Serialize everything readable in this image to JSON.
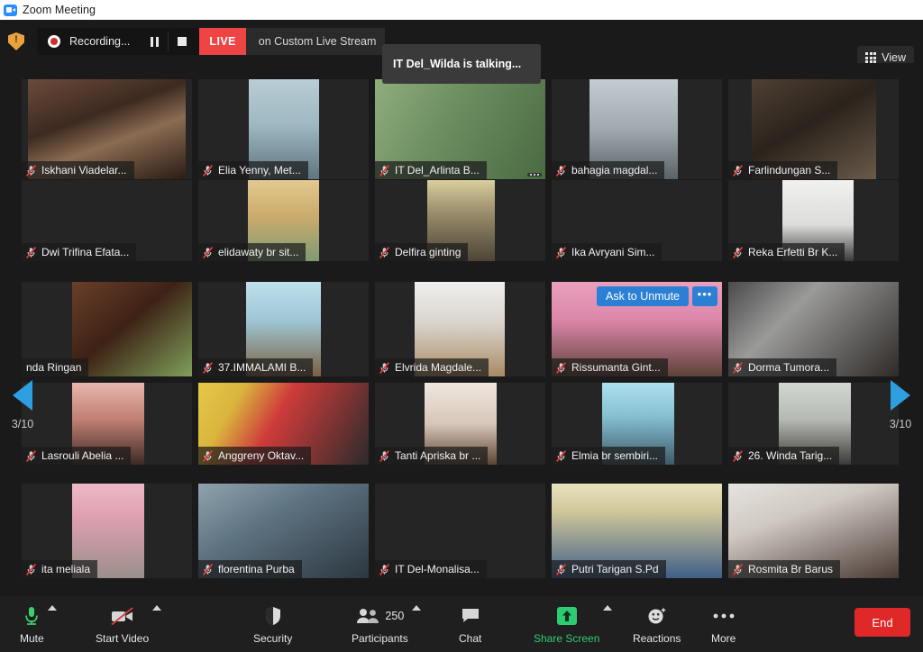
{
  "window": {
    "title": "Zoom Meeting",
    "logo_icon": "zoom-logo-icon"
  },
  "topbar": {
    "shield_icon": "security-shield-icon",
    "recording": {
      "label": "Recording...",
      "record_icon": "record-dot-icon",
      "pause_icon": "pause-icon",
      "stop_icon": "stop-icon"
    },
    "live": {
      "badge": "LIVE",
      "text": "on Custom Live Stream"
    },
    "talking_tooltip": "IT Del_Wilda is talking...",
    "view": {
      "label": "View",
      "icon": "grid-view-icon"
    }
  },
  "gallery": {
    "page_left": "3/10",
    "page_right": "3/10",
    "prev_icon": "chevron-left-icon",
    "next_icon": "chevron-right-icon",
    "mute_icon": "muted-microphone-icon",
    "unmute_prompt": {
      "label": "Ask to Unmute",
      "more_label": "•••"
    },
    "rows": [
      {
        "cells": [
          {
            "name": "Iskhani Viadelar...",
            "muted": true,
            "video": true,
            "vx": 7,
            "vy": 0,
            "vw": 175,
            "vh": 111,
            "bg": "linear-gradient(160deg,#6b4b3a 0%,#3d2a20 38%,#8a6c52 60%,#2a1c14 100%)"
          },
          {
            "name": "Elia Yenny, Met...",
            "muted": true,
            "video": true,
            "vx": 56,
            "vy": 0,
            "vw": 78,
            "vh": 111,
            "bg": "linear-gradient(180deg,#b9cdd4 0%,#9fb8c2 45%,#5f7580 100%)"
          },
          {
            "name": "IT Del_Arlinta B...",
            "muted": true,
            "video": true,
            "vx": 0,
            "vy": 0,
            "vw": 189,
            "vh": 111,
            "bg": "linear-gradient(120deg,#8fae7e 0%,#6d8f62 40%,#4a6a42 100%)",
            "sharedots": true
          },
          {
            "name": "bahagia magdal...",
            "muted": true,
            "video": true,
            "vx": 42,
            "vy": 0,
            "vw": 98,
            "vh": 111,
            "bg": "linear-gradient(180deg,#c3cdd2 0%,#9fa9ae 50%,#5b6267 100%)"
          },
          {
            "name": "Farlindungan S...",
            "muted": true,
            "video": true,
            "vx": 26,
            "vy": 0,
            "vw": 138,
            "vh": 111,
            "bg": "linear-gradient(150deg,#4e4034 0%,#2b231c 45%,#6a5a49 100%)"
          }
        ]
      },
      {
        "cells": [
          {
            "name": "Dwi Trifina Efata...",
            "muted": true,
            "video": false,
            "vx": 0,
            "vy": 0,
            "vw": 0,
            "vh": 0,
            "bg": ""
          },
          {
            "name": "elidawaty br sit...",
            "muted": true,
            "video": true,
            "vx": 55,
            "vy": 0,
            "vw": 79,
            "vh": 90,
            "bg": "linear-gradient(180deg,#e2c98f 0%,#cbab6c 45%,#7f9a74 100%)"
          },
          {
            "name": "Delfira ginting",
            "muted": true,
            "video": true,
            "vx": 58,
            "vy": 0,
            "vw": 75,
            "vh": 90,
            "bg": "linear-gradient(180deg,#d9cf9e 0%,#9a8d6b 40%,#4c4436 100%)"
          },
          {
            "name": "Ika Avryani Sim...",
            "muted": true,
            "video": false,
            "vx": 0,
            "vy": 0,
            "vw": 0,
            "vh": 0,
            "bg": ""
          },
          {
            "name": "Reka Erfetti Br K...",
            "muted": true,
            "video": true,
            "vx": 60,
            "vy": 0,
            "vw": 79,
            "vh": 90,
            "bg": "linear-gradient(180deg,#f1f1ef 0%,#dcdcda 55%,#3a3a3c 100%)"
          }
        ]
      },
      {
        "cells": [
          {
            "name": "nda Ringan",
            "muted": false,
            "video": true,
            "vx": 56,
            "vy": 0,
            "vw": 133,
            "vh": 105,
            "bg": "linear-gradient(140deg,#6a3f2a 0%,#3d2215 45%,#7fa05a 100%)"
          },
          {
            "name": "37.IMMALAMI B...",
            "muted": true,
            "video": true,
            "vx": 53,
            "vy": 0,
            "vw": 83,
            "vh": 105,
            "bg": "linear-gradient(180deg,#bfe0ec 0%,#9ec7d6 40%,#7a6040 100%)"
          },
          {
            "name": "Elvrida Magdale...",
            "muted": true,
            "video": true,
            "vx": 44,
            "vy": 0,
            "vw": 100,
            "vh": 105,
            "bg": "linear-gradient(180deg,#f0efed 0%,#d9d3cb 45%,#a98a63 100%)"
          },
          {
            "name": "Rissumanta Gint...",
            "muted": true,
            "video": true,
            "vx": 0,
            "vy": 0,
            "vw": 189,
            "vh": 105,
            "bg": "linear-gradient(180deg,#e9a0bd 0%,#dd87ab 40%,#5d4238 100%)",
            "unmute": true
          },
          {
            "name": "Dorma Tumora...",
            "muted": true,
            "video": true,
            "vx": 0,
            "vy": 0,
            "vw": 189,
            "vh": 105,
            "bg": "linear-gradient(135deg,#4a4a4c 0%,#9a9a98 35%,#2e2a28 100%)"
          }
        ]
      },
      {
        "cells": [
          {
            "name": "Lasrouli Abelia ...",
            "muted": true,
            "video": true,
            "vx": 56,
            "vy": 0,
            "vw": 80,
            "vh": 91,
            "bg": "linear-gradient(180deg,#e8b7ae 0%,#c07f73 45%,#3d2a26 100%)"
          },
          {
            "name": "Anggreny Oktav...",
            "muted": true,
            "video": true,
            "vx": 0,
            "vy": 0,
            "vw": 189,
            "vh": 91,
            "bg": "linear-gradient(120deg,#e6c84a 0%,#d9b53c 22%,#cf3b3b 45%,#2b2b2b 100%)"
          },
          {
            "name": "Tanti Apriska br ...",
            "muted": true,
            "video": true,
            "vx": 55,
            "vy": 0,
            "vw": 80,
            "vh": 91,
            "bg": "linear-gradient(180deg,#efe7e0 0%,#d7c6b8 50%,#5d4535 100%)"
          },
          {
            "name": "Elmia br sembiri...",
            "muted": true,
            "video": true,
            "vx": 56,
            "vy": 0,
            "vw": 80,
            "vh": 91,
            "bg": "linear-gradient(180deg,#aee0ee 0%,#86c0d4 40%,#3f5a66 100%)"
          },
          {
            "name": "26. Winda Tarig...",
            "muted": true,
            "video": true,
            "vx": 56,
            "vy": 0,
            "vw": 80,
            "vh": 91,
            "bg": "linear-gradient(180deg,#d2d7d1 0%,#b4b9b3 45%,#3c3a36 100%)"
          }
        ]
      },
      {
        "cells": [
          {
            "name": "ita meliala",
            "muted": true,
            "video": true,
            "vx": 56,
            "vy": 0,
            "vw": 80,
            "vh": 105,
            "bg": "linear-gradient(180deg,#edb9c6 0%,#dfa0b1 35%,#9a8f8a 100%)"
          },
          {
            "name": "florentina Purba",
            "muted": true,
            "video": true,
            "vx": 0,
            "vy": 0,
            "vw": 189,
            "vh": 105,
            "bg": "linear-gradient(150deg,#8fa3ae 0%,#5d7280 40%,#2c3740 100%)"
          },
          {
            "name": "IT Del-Monalisa...",
            "muted": true,
            "video": false,
            "vx": 0,
            "vy": 0,
            "vw": 0,
            "vh": 0,
            "bg": ""
          },
          {
            "name": "Putri Tarigan S.Pd",
            "muted": true,
            "video": true,
            "vx": 0,
            "vy": 0,
            "vw": 189,
            "vh": 105,
            "bg": "linear-gradient(180deg,#e9e3bc 0%,#cfc69a 30%,#3f5f86 100%)"
          },
          {
            "name": "Rosmita Br Barus",
            "muted": true,
            "video": true,
            "vx": 0,
            "vy": 0,
            "vw": 189,
            "vh": 105,
            "bg": "linear-gradient(160deg,#e7e3de 0%,#cfc9c2 35%,#4a3a34 100%)"
          }
        ]
      }
    ]
  },
  "toolbar": {
    "items": [
      {
        "label": "Mute",
        "icon": "microphone-icon",
        "caret": true,
        "green_label": false
      },
      {
        "label": "Start Video",
        "icon": "video-off-icon",
        "caret": true,
        "green_label": false
      },
      {
        "label": "Security",
        "icon": "shield-icon",
        "caret": false,
        "green_label": false
      },
      {
        "label": "Participants",
        "icon": "participants-icon",
        "caret": true,
        "green_label": false,
        "count": "250"
      },
      {
        "label": "Chat",
        "icon": "chat-bubble-icon",
        "caret": false,
        "green_label": false
      },
      {
        "label": "Share Screen",
        "icon": "share-screen-icon",
        "caret": true,
        "green_label": true
      },
      {
        "label": "Reactions",
        "icon": "reactions-icon",
        "caret": false,
        "green_label": false
      },
      {
        "label": "More",
        "icon": "more-dots-icon",
        "caret": false,
        "green_label": false
      }
    ],
    "end_label": "End"
  },
  "colors": {
    "accent_blue": "#2d9ee0",
    "live_red": "#ef4444",
    "end_red": "#e02828",
    "share_green": "#2ecc71",
    "unmute_blue": "#2b7fd4"
  }
}
